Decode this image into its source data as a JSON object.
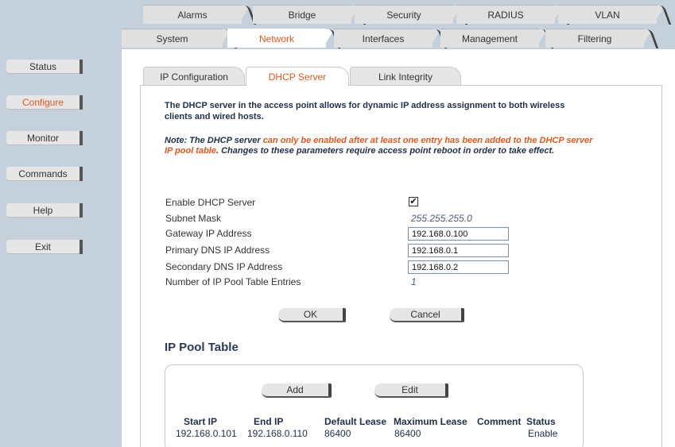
{
  "top_tabs_row1": [
    "Alarms",
    "Bridge",
    "Security",
    "RADIUS",
    "VLAN"
  ],
  "top_tabs_row2": [
    "System",
    "Network",
    "Interfaces",
    "Management",
    "Filtering"
  ],
  "active_top_tab": "Network",
  "nav": {
    "items": [
      "Status",
      "Configure",
      "Monitor",
      "Commands",
      "Help",
      "Exit"
    ],
    "active": "Configure"
  },
  "subtabs": [
    "IP Configuration",
    "DHCP Server",
    "Link Integrity"
  ],
  "active_subtab": "DHCP Server",
  "description": "The DHCP server in the access point allows for dynamic IP address assignment to both wireless clients and wired hosts.",
  "note": {
    "part1": "Note: The DHCP server ",
    "part2": "can only be enabled after at least one entry has been added to the DHCP server IP pool table",
    "part3": ". Changes to these parameters require access point reboot in order to take effect."
  },
  "form": {
    "enable_label": "Enable DHCP Server",
    "enable_checked": "✔",
    "subnet_label": "Subnet Mask",
    "subnet_value": "255.255.255.0",
    "gateway_label": "Gateway IP Address",
    "gateway_value": "192.168.0.100",
    "primary_dns_label": "Primary DNS IP Address",
    "primary_dns_value": "192.168.0.1",
    "secondary_dns_label": "Secondary DNS IP Address",
    "secondary_dns_value": "192.168.0.2",
    "pool_entries_label": "Number of IP Pool Table Entries",
    "pool_entries_value": "1"
  },
  "buttons": {
    "ok": "OK",
    "cancel": "Cancel",
    "add": "Add",
    "edit": "Edit"
  },
  "pool_table": {
    "title": "IP Pool Table",
    "headers": [
      "Start IP",
      "End IP",
      "Default Lease",
      "Maximum Lease",
      "Comment",
      "Status"
    ],
    "row": [
      "192.168.0.101",
      "192.168.0.110",
      "86400",
      "86400",
      "",
      "Enable"
    ]
  },
  "colors": {
    "accent": "#e8561b",
    "nav_bg": "#c5d0dd",
    "text_dark": "#1f2f4a"
  }
}
